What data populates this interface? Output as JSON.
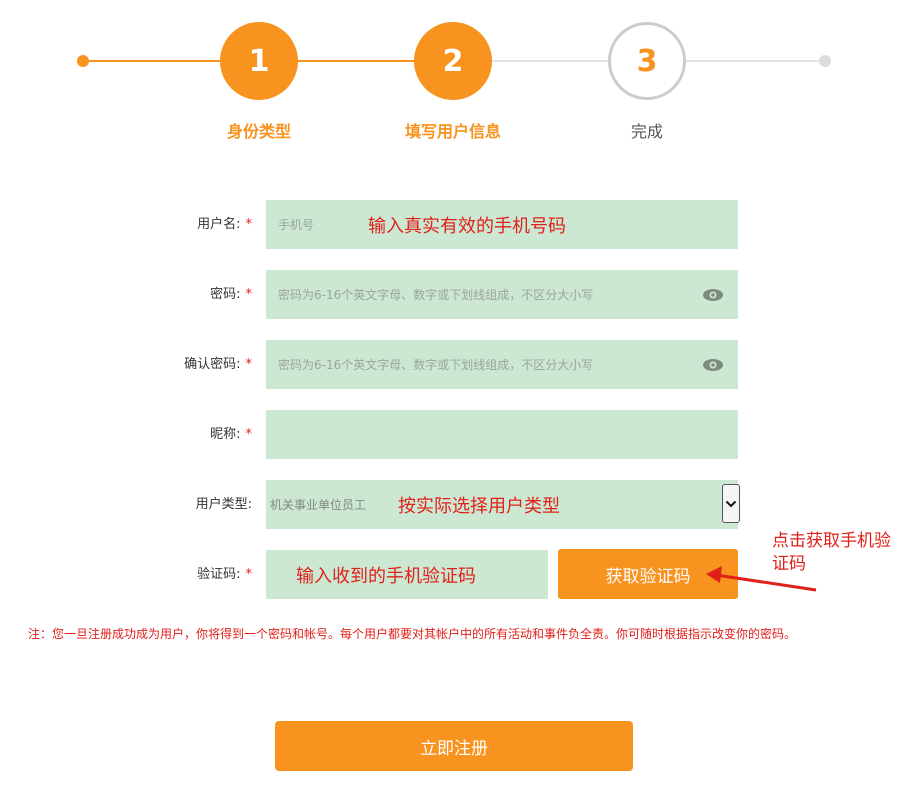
{
  "stepper": {
    "steps": [
      {
        "number": "1",
        "label": "身份类型",
        "state": "done"
      },
      {
        "number": "2",
        "label": "填写用户信息",
        "state": "done"
      },
      {
        "number": "3",
        "label": "完成",
        "state": "pending"
      }
    ]
  },
  "form": {
    "required_mark": "*",
    "username": {
      "label": "用户名:",
      "placeholder": "手机号",
      "annotation": "输入真实有效的手机号码"
    },
    "password": {
      "label": "密码:",
      "placeholder": "密码为6-16个英文字母、数字或下划线组成，不区分大小写",
      "icon": "eye-icon"
    },
    "confirm_password": {
      "label": "确认密码:",
      "placeholder": "密码为6-16个英文字母、数字或下划线组成，不区分大小写",
      "icon": "eye-icon"
    },
    "nickname": {
      "label": "昵称:",
      "value": ""
    },
    "user_type": {
      "label": "用户类型:",
      "selected": "机关事业单位员工",
      "annotation": "按实际选择用户类型",
      "icon": "chevron-down-icon"
    },
    "verification": {
      "label": "验证码:",
      "annotation": "输入收到的手机验证码",
      "button_label": "获取验证码",
      "side_note": "点击获取手机验证码"
    }
  },
  "notice": "注：您一旦注册成功成为用户，你将得到一个密码和帐号。每个用户都要对其帐户中的所有活动和事件负全责。你可随时根据指示改变你的密码。",
  "submit_label": "立即注册",
  "colors": {
    "accent": "#f7931e",
    "field_bg": "#cde8d2",
    "annotation_red": "#e0201a",
    "pending_gray": "#cccccc"
  }
}
